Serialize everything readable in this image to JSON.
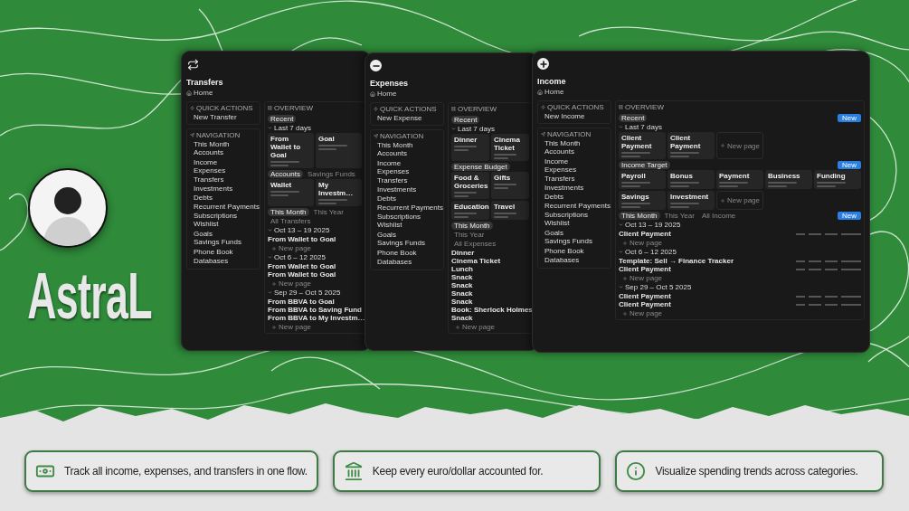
{
  "brand": {
    "name": "AstraL"
  },
  "windows": [
    {
      "kind": "transfers",
      "title": "Transfers",
      "breadcrumb": "Home",
      "quick_actions": {
        "heading": "QUICK ACTIONS",
        "items": [
          "New Transfer"
        ]
      },
      "navigation": {
        "heading": "NAVIGATION",
        "groups": [
          {
            "items": [
              "This Month",
              "Accounts"
            ]
          },
          {
            "items": [
              "Income",
              "Expenses",
              "Transfers"
            ]
          },
          {
            "items": [
              "Investments",
              "Debts"
            ]
          },
          {
            "items": [
              "Recurrent Payments",
              "Subscriptions",
              "Wishlist"
            ]
          },
          {
            "items": [
              "Goals",
              "Savings Funds"
            ]
          },
          {
            "items": [
              "Phone Book"
            ]
          },
          {
            "items": [
              "Databases"
            ]
          }
        ]
      },
      "overview": {
        "heading": "OVERVIEW",
        "blocks": [
          {
            "kind": "tabs",
            "items": [
              {
                "label": "Recent",
                "selected": true
              }
            ]
          },
          {
            "kind": "group",
            "label": "Last 7 days"
          },
          {
            "kind": "cards",
            "cards": [
              {
                "title": "From Wallet to Goal"
              },
              {
                "title": "Goal"
              }
            ]
          },
          {
            "kind": "tabs",
            "items": [
              {
                "label": "Accounts",
                "selected": true
              },
              {
                "label": "Savings Funds",
                "selected": false
              }
            ]
          },
          {
            "kind": "cards",
            "cards": [
              {
                "title": "Wallet"
              },
              {
                "title": "My Investm…"
              }
            ]
          },
          {
            "kind": "tabs",
            "items": [
              {
                "label": "This Month",
                "selected": true
              },
              {
                "label": "This Year",
                "selected": false
              },
              {
                "label": "All Transfers",
                "selected": false
              }
            ]
          },
          {
            "kind": "group",
            "label": "Oct 13 – 19 2025"
          },
          {
            "kind": "rows",
            "items": [
              {
                "label": "From Wallet to Goal"
              }
            ]
          },
          {
            "kind": "more",
            "label": "New page"
          },
          {
            "kind": "group",
            "label": "Oct 6 – 12 2025"
          },
          {
            "kind": "rows",
            "items": [
              {
                "label": "From Wallet to Goal"
              },
              {
                "label": "From Wallet to Goal"
              }
            ]
          },
          {
            "kind": "more",
            "label": "New page"
          },
          {
            "kind": "group",
            "label": "Sep 29 – Oct 5 2025"
          },
          {
            "kind": "rows",
            "items": [
              {
                "label": "From BBVA to Goal"
              },
              {
                "label": "From BBVA to Saving Fund"
              },
              {
                "label": "From BBVA to My Investm…"
              }
            ]
          },
          {
            "kind": "more",
            "label": "New page"
          }
        ]
      }
    },
    {
      "kind": "expenses",
      "title": "Expenses",
      "breadcrumb": "Home",
      "quick_actions": {
        "heading": "QUICK ACTIONS",
        "items": [
          "New Expense"
        ]
      },
      "navigation": {
        "heading": "NAVIGATION",
        "groups": [
          {
            "items": [
              "This Month",
              "Accounts"
            ]
          },
          {
            "items": [
              "Income",
              "Expenses",
              "Transfers"
            ]
          },
          {
            "items": [
              "Investments",
              "Debts"
            ]
          },
          {
            "items": [
              "Recurrent Payments",
              "Subscriptions",
              "Wishlist"
            ]
          },
          {
            "items": [
              "Goals",
              "Savings Funds"
            ]
          },
          {
            "items": [
              "Phone Book"
            ]
          },
          {
            "items": [
              "Databases"
            ]
          }
        ]
      },
      "overview": {
        "heading": "OVERVIEW",
        "blocks": [
          {
            "kind": "tabs",
            "items": [
              {
                "label": "Recent",
                "selected": true
              }
            ]
          },
          {
            "kind": "group",
            "label": "Last 7 days"
          },
          {
            "kind": "cards",
            "cards": [
              {
                "title": "Dinner"
              },
              {
                "title": "Cinema Ticket"
              }
            ]
          },
          {
            "kind": "tabs",
            "items": [
              {
                "label": "Expense Budget",
                "selected": true
              }
            ]
          },
          {
            "kind": "cards",
            "cards": [
              {
                "title": "Food & Groceries"
              },
              {
                "title": "Gifts"
              },
              {
                "title": "Education"
              },
              {
                "title": "Travel"
              }
            ]
          },
          {
            "kind": "tabs",
            "items": [
              {
                "label": "This Month",
                "selected": true
              },
              {
                "label": "This Year",
                "selected": false
              },
              {
                "label": "All Expenses",
                "selected": false
              }
            ]
          },
          {
            "kind": "rows",
            "items": [
              {
                "label": "Dinner"
              },
              {
                "label": "Cinema Ticket"
              },
              {
                "label": "Lunch"
              },
              {
                "label": "Snack"
              },
              {
                "label": "Snack"
              },
              {
                "label": "Snack"
              },
              {
                "label": "Snack"
              },
              {
                "label": "Book: Sherlock Holmes"
              },
              {
                "label": "Snack"
              }
            ]
          },
          {
            "kind": "more",
            "label": "New page"
          }
        ]
      }
    },
    {
      "kind": "income",
      "title": "Income",
      "breadcrumb": "Home",
      "quick_actions": {
        "heading": "QUICK ACTIONS",
        "items": [
          "New Income"
        ]
      },
      "navigation": {
        "heading": "NAVIGATION",
        "groups": [
          {
            "items": [
              "This Month",
              "Accounts"
            ]
          },
          {
            "items": [
              "Income",
              "Expenses",
              "Transfers"
            ]
          },
          {
            "items": [
              "Investments",
              "Debts"
            ]
          },
          {
            "items": [
              "Recurrent Payments",
              "Subscriptions",
              "Wishlist"
            ]
          },
          {
            "items": [
              "Goals",
              "Savings Funds"
            ]
          },
          {
            "items": [
              "Phone Book"
            ]
          },
          {
            "items": [
              "Databases"
            ]
          }
        ]
      },
      "overview": {
        "heading": "OVERVIEW",
        "blocks": [
          {
            "kind": "tabs",
            "items": [
              {
                "label": "Recent",
                "selected": true
              }
            ],
            "action": "New"
          },
          {
            "kind": "group",
            "label": "Last 7 days"
          },
          {
            "kind": "cards",
            "cards": [
              {
                "title": "Client Payment"
              },
              {
                "title": "Client Payment"
              }
            ],
            "new_card": "New page"
          },
          {
            "kind": "tabs",
            "items": [
              {
                "label": "Income Target",
                "selected": true
              }
            ],
            "action": "New"
          },
          {
            "kind": "cards",
            "cards": [
              {
                "title": "Payroll"
              },
              {
                "title": "Bonus"
              },
              {
                "title": "Payment"
              },
              {
                "title": "Business"
              },
              {
                "title": "Funding"
              },
              {
                "title": "Savings"
              },
              {
                "title": "Investment"
              }
            ],
            "new_card": "New page"
          },
          {
            "kind": "tabs",
            "items": [
              {
                "label": "This Month",
                "selected": true
              },
              {
                "label": "This Year",
                "selected": false
              },
              {
                "label": "All Income",
                "selected": false
              }
            ],
            "action": "New"
          },
          {
            "kind": "group",
            "label": "Oct 13 – 19 2025"
          },
          {
            "kind": "rows",
            "items": [
              {
                "label": "Client Payment"
              }
            ]
          },
          {
            "kind": "more",
            "label": "New page"
          },
          {
            "kind": "group",
            "label": "Oct 6 – 12 2025"
          },
          {
            "kind": "rows",
            "items": [
              {
                "label": "Template: Sell → Finance Tracker"
              },
              {
                "label": "Client Payment"
              }
            ]
          },
          {
            "kind": "more",
            "label": "New page"
          },
          {
            "kind": "group",
            "label": "Sep 29 – Oct 5 2025"
          },
          {
            "kind": "rows",
            "items": [
              {
                "label": "Client Payment"
              },
              {
                "label": "Client Payment"
              }
            ]
          },
          {
            "kind": "more",
            "label": "New page"
          }
        ]
      }
    }
  ],
  "features": [
    {
      "kind": "money",
      "text": "Track all income, expenses, and transfers in one flow."
    },
    {
      "kind": "bank",
      "text": "Keep every euro/dollar accounted for."
    },
    {
      "kind": "info",
      "text": "Visualize spending trends across categories."
    }
  ]
}
